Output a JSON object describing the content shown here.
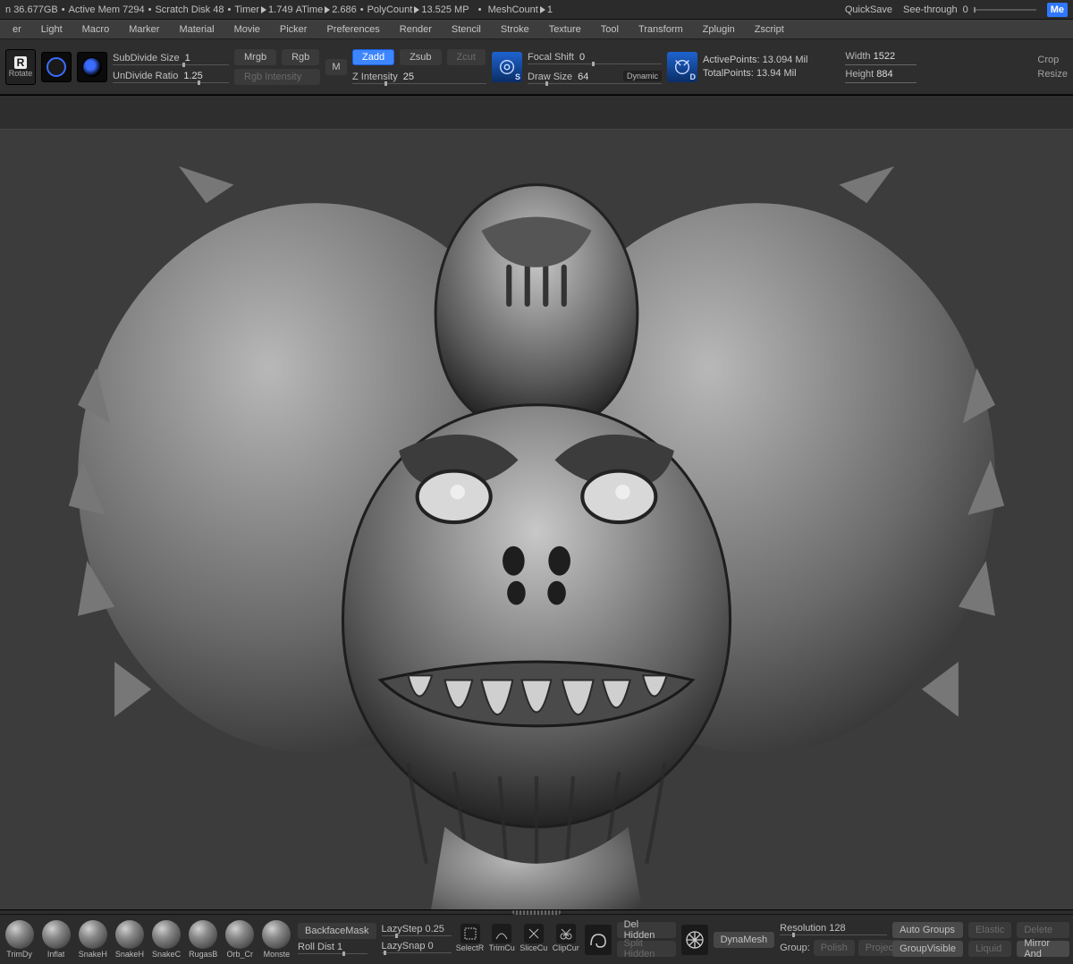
{
  "status": {
    "mem": "36.677GB",
    "active_mem": "Active Mem 7294",
    "scratch": "Scratch Disk 48",
    "timer_lbl": "Timer",
    "timer": "1.749",
    "atime_lbl": "ATime",
    "atime": "2.686",
    "poly_lbl": "PolyCount",
    "poly": "13.525 MP",
    "mesh_lbl": "MeshCount",
    "mesh": "1",
    "quicksave": "QuickSave",
    "seethrough_lbl": "See-through",
    "seethrough_val": "0",
    "me_btn": "Me"
  },
  "menu": [
    "er",
    "Light",
    "Macro",
    "Marker",
    "Material",
    "Movie",
    "Picker",
    "Preferences",
    "Render",
    "Stencil",
    "Stroke",
    "Texture",
    "Tool",
    "Transform",
    "Zplugin",
    "Zscript"
  ],
  "tools": {
    "rotate": "Rotate",
    "subdivide_lbl": "SubDivide Size",
    "subdivide_val": "1",
    "undivide_lbl": "UnDivide Ratio",
    "undivide_val": "1.25",
    "mrgb": "Mrgb",
    "rgb": "Rgb",
    "rgb_intensity": "Rgb Intensity",
    "m": "M",
    "zadd": "Zadd",
    "zsub": "Zsub",
    "zcut": "Zcut",
    "zintensity_lbl": "Z Intensity",
    "zintensity_val": "25",
    "focal_lbl": "Focal Shift",
    "focal_val": "0",
    "draw_lbl": "Draw Size",
    "draw_val": "64",
    "dynamic": "Dynamic",
    "active_pts_lbl": "ActivePoints:",
    "active_pts_val": "13.094 Mil",
    "total_pts_lbl": "TotalPoints:",
    "total_pts_val": "13.94 Mil",
    "width_lbl": "Width",
    "width_val": "1522",
    "height_lbl": "Height",
    "height_val": "884",
    "crop": "Crop",
    "resize": "Resize"
  },
  "bottom": {
    "brushes": [
      "TrimDy",
      "Inflat",
      "SnakeH",
      "SnakeH",
      "SnakeC",
      "RugasB",
      "Orb_Cr",
      "Monste"
    ],
    "backface": "BackfaceMask",
    "rolldist_lbl": "Roll Dist",
    "rolldist_val": "1",
    "lazystep_lbl": "LazyStep",
    "lazystep_val": "0.25",
    "lazysnap_lbl": "LazySnap",
    "lazysnap_val": "0",
    "small_icons": [
      "SelectR",
      "TrimCu",
      "SliceCu",
      "ClipCur"
    ],
    "delhidden": "Del Hidden",
    "splithidden": "Split Hidden",
    "dynamesh": "DynaMesh",
    "res_lbl": "Resolution",
    "res_val": "128",
    "group": "Group:",
    "polish": "Polish",
    "project": "Project",
    "autogroups": "Auto Groups",
    "groupvisible": "GroupVisible",
    "elastic": "Elastic",
    "liquid": "Liquid",
    "delete": "Delete",
    "mirror": "Mirror And"
  }
}
